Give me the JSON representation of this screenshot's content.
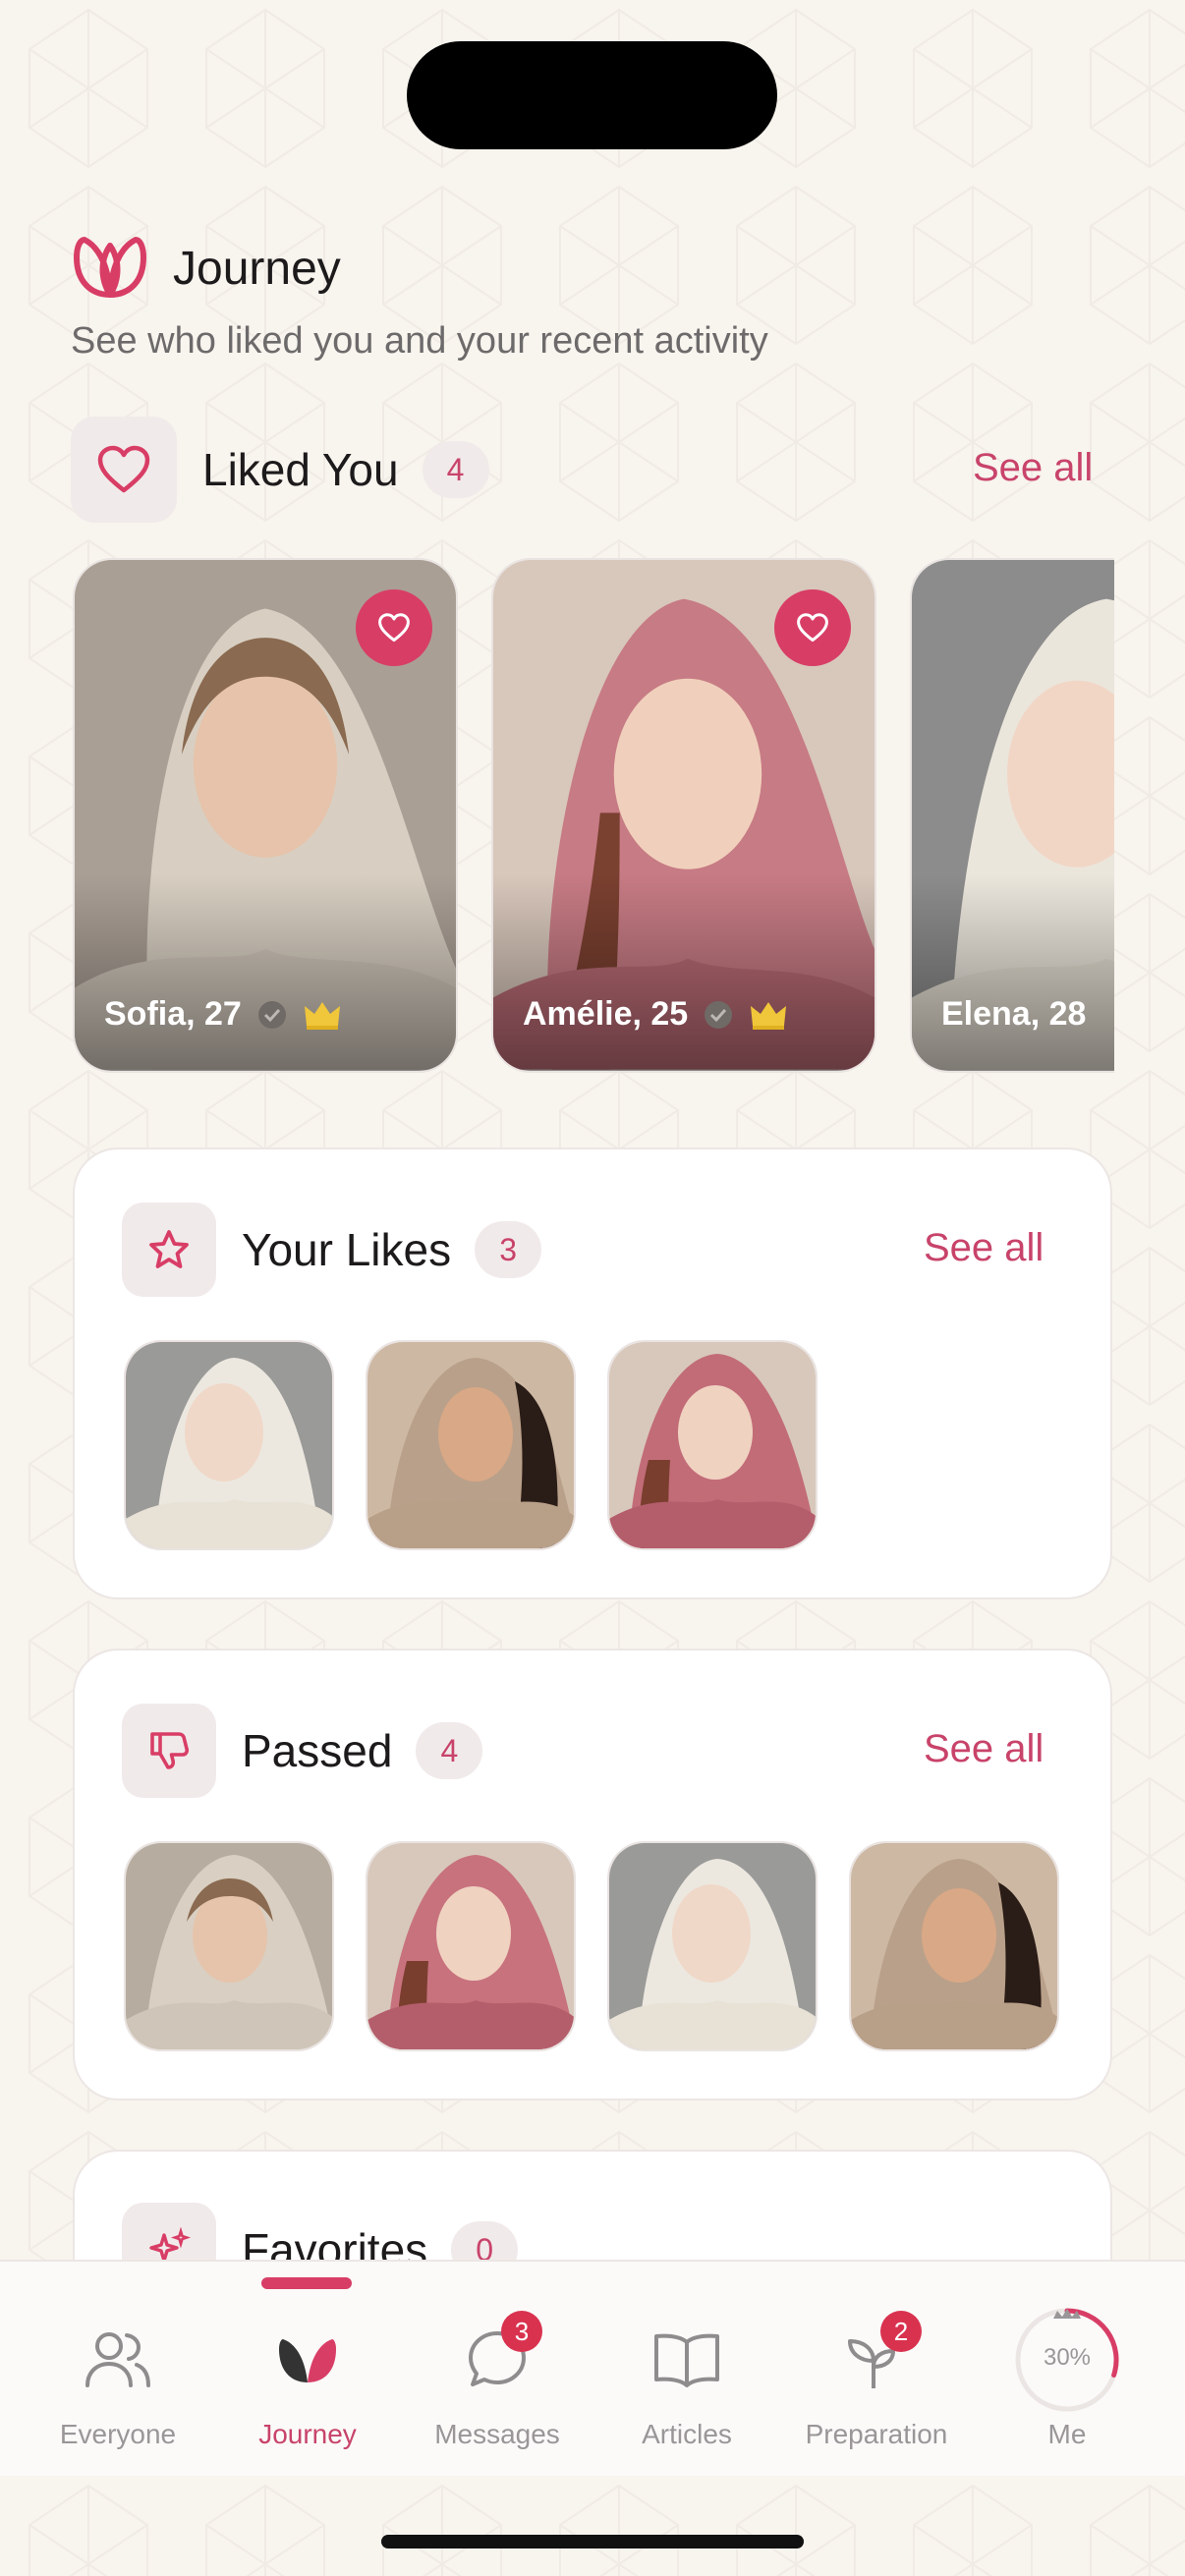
{
  "header": {
    "title": "Journey",
    "subtitle": "See who liked you and your recent activity"
  },
  "liked_you": {
    "title": "Liked You",
    "count": "4",
    "see_all": "See all",
    "cards": [
      {
        "name": "Sofia, 27",
        "verified": true,
        "premium": true
      },
      {
        "name": "Amélie, 25",
        "verified": true,
        "premium": true
      },
      {
        "name": "Elena, 28",
        "verified": false,
        "premium": false
      }
    ]
  },
  "your_likes": {
    "title": "Your Likes",
    "count": "3",
    "see_all": "See all"
  },
  "passed": {
    "title": "Passed",
    "count": "4",
    "see_all": "See all"
  },
  "favorites": {
    "title": "Favorites",
    "count": "0"
  },
  "tabbar": {
    "tabs": [
      {
        "label": "Everyone",
        "icon": "users-icon"
      },
      {
        "label": "Journey",
        "icon": "lotus-icon",
        "active": true
      },
      {
        "label": "Messages",
        "icon": "chat-icon",
        "badge": "3"
      },
      {
        "label": "Articles",
        "icon": "book-icon"
      },
      {
        "label": "Preparation",
        "icon": "sprout-icon",
        "badge": "2"
      },
      {
        "label": "Me",
        "icon": "profile-progress-icon"
      }
    ],
    "me_progress": "30%"
  },
  "colors": {
    "accent": "#d83d66",
    "accent_text": "#c8436a",
    "background": "#f8f4ee",
    "badge_red": "#d9324f"
  }
}
